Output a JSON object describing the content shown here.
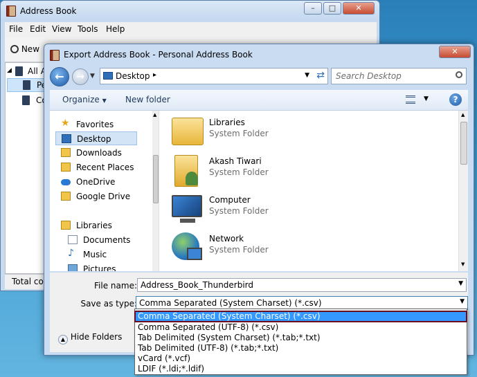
{
  "address_book": {
    "title": "Address Book",
    "menu": [
      "File",
      "Edit",
      "View",
      "Tools",
      "Help"
    ],
    "toolbar_new": "New",
    "tree": [
      "All A",
      "Pe",
      "Co"
    ],
    "status": "Total co"
  },
  "dialog": {
    "title": "Export Address Book - Personal Address Book",
    "address_location": "Desktop",
    "search_placeholder": "Search Desktop",
    "organize_label": "Organize",
    "new_folder_label": "New folder",
    "nav": {
      "favorites": "Favorites",
      "items": [
        "Desktop",
        "Downloads",
        "Recent Places",
        "OneDrive",
        "Google Drive"
      ],
      "libraries": "Libraries",
      "lib_items": [
        "Documents",
        "Music",
        "Pictures"
      ]
    },
    "files": [
      {
        "name": "Libraries",
        "type": "System Folder"
      },
      {
        "name": "Akash Tiwari",
        "type": "System Folder"
      },
      {
        "name": "Computer",
        "type": "System Folder"
      },
      {
        "name": "Network",
        "type": "System Folder"
      }
    ],
    "file_name_label": "File name:",
    "file_name_value": "Address_Book_Thunderbird",
    "save_type_label": "Save as type:",
    "save_type_value": "Comma Separated (System Charset) (*.csv)",
    "hide_folders_label": "Hide Folders",
    "type_options": [
      "Comma Separated (System Charset) (*.csv)",
      "Comma Separated (UTF-8) (*.csv)",
      "Tab Delimited (System Charset) (*.tab;*.txt)",
      "Tab Delimited (UTF-8) (*.tab;*.txt)",
      "vCard (*.vcf)",
      "LDIF (*.ldi;*.ldif)"
    ]
  },
  "colors": {
    "selection": "#3399ff",
    "selection_border": "#6b0d1f",
    "accent": "#1e395b"
  }
}
